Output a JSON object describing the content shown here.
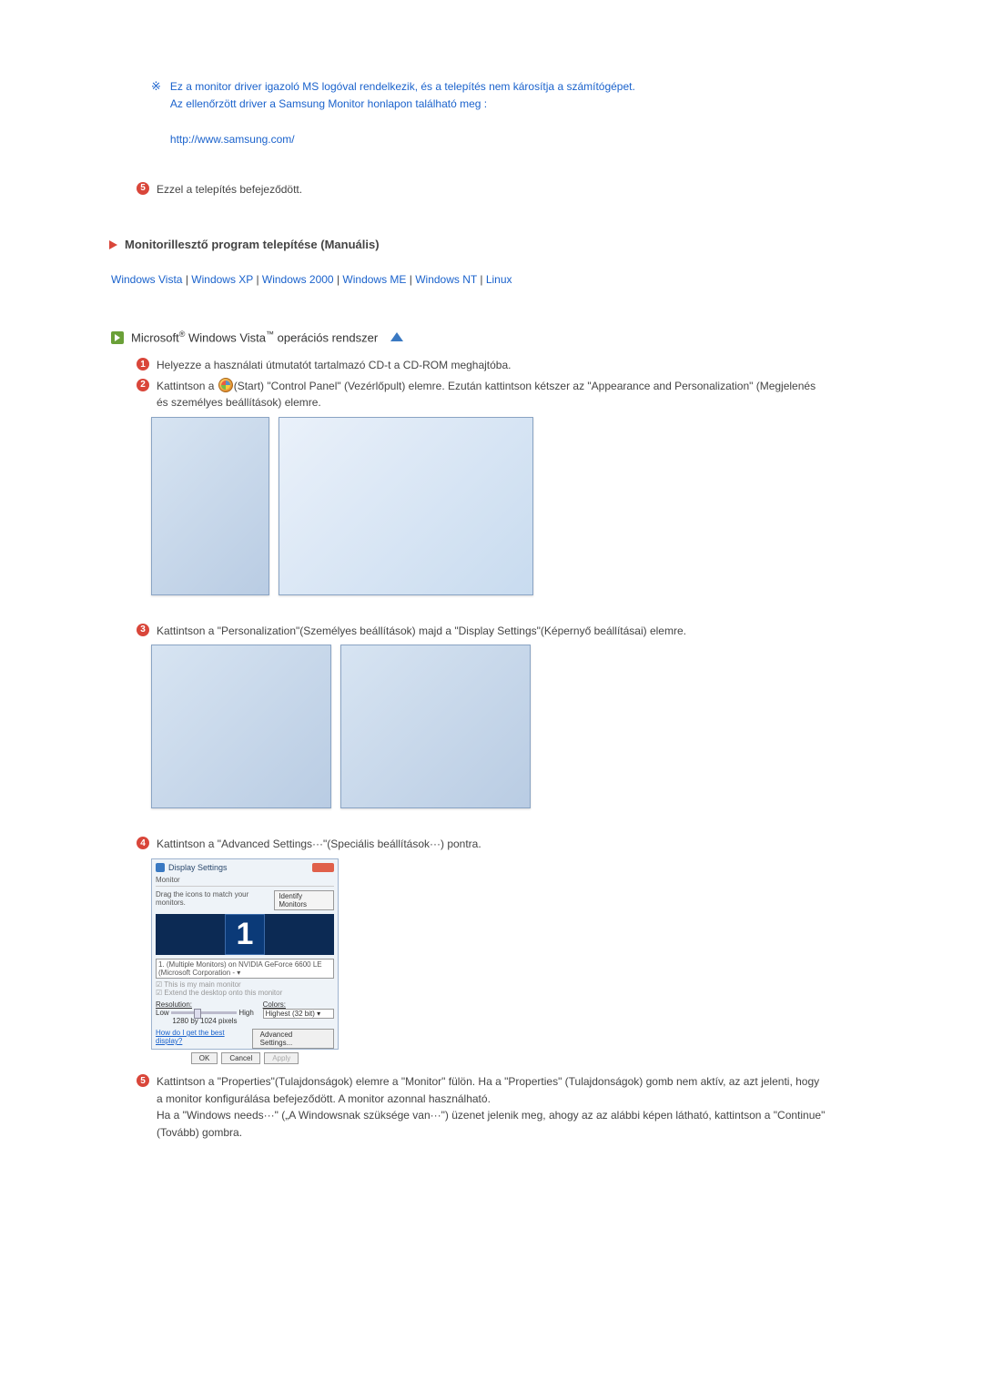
{
  "note": {
    "line1": "Ez a monitor driver igazoló MS logóval rendelkezik, és a telepítés nem károsítja a számítógépet.",
    "line2": "Az ellenőrzött driver a Samsung Monitor honlapon található meg :",
    "url": "http://www.samsung.com/"
  },
  "completion": "Ezzel a telepítés befejeződött.",
  "heading": "Monitorillesztő program telepítése (Manuális)",
  "os_links": {
    "vista": "Windows Vista",
    "xp": "Windows XP",
    "w2000": "Windows 2000",
    "me": "Windows ME",
    "nt": "Windows NT",
    "linux": "Linux",
    "sep": " | "
  },
  "vista_title": "Microsoft® Windows Vista™ operációs rendszer",
  "steps": {
    "n1": "1",
    "s1": "Helyezze a használati útmutatót tartalmazó CD-t a CD-ROM meghajtóba.",
    "n2": "2",
    "s2a": "Kattintson a ",
    "s2b": "(Start) \"Control Panel\" (Vezérlőpult) elemre. Ezután kattintson kétszer az \"Appearance and Personalization\" (Megjelenés és személyes beállítások) elemre.",
    "n3": "3",
    "s3": "Kattintson a \"Personalization\"(Személyes beállítások) majd a \"Display Settings\"(Képernyő beállításai) elemre.",
    "n4": "4",
    "s4": "Kattintson a \"Advanced Settings···\"(Speciális beállítások···) pontra.",
    "n5": "5",
    "s5": "Kattintson a \"Properties\"(Tulajdonságok) elemre a \"Monitor\" fülön. Ha a \"Properties\" (Tulajdonságok) gomb nem aktív, az azt jelenti, hogy a monitor konfigurálása befejeződött. A monitor azonnal használható.\nHa a \"Windows needs···\" („A Windowsnak szüksége van···\") üzenet jelenik meg, ahogy az az alábbi képen látható, kattintson a \"Continue\"(Tovább) gombra."
  },
  "display_dialog": {
    "title": "Display Settings",
    "tab": "Monitor",
    "drag": "Drag the icons to match your monitors.",
    "identify": "Identify Monitors",
    "mon_num": "1",
    "devline": "1. (Multiple Monitors) on NVIDIA GeForce 6600 LE (Microsoft Corporation - ▾",
    "cb_main": "This is my main monitor",
    "cb_extend": "Extend the desktop onto this monitor",
    "res_label": "Resolution:",
    "low": "Low",
    "high": "High",
    "res_value": "1280 by 1024 pixels",
    "colors_label": "Colors:",
    "colors_value": "Highest (32 bit)",
    "help": "How do I get the best display?",
    "adv": "Advanced Settings...",
    "ok": "OK",
    "cancel": "Cancel",
    "apply": "Apply"
  }
}
